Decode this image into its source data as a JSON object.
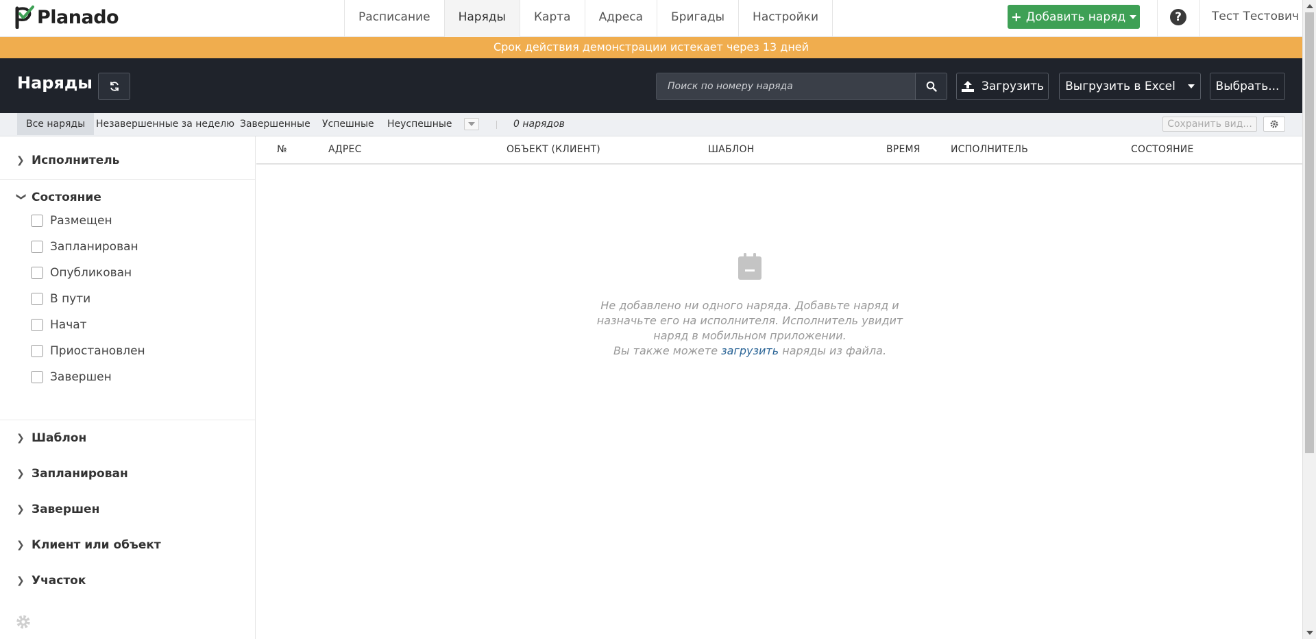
{
  "app": {
    "logo_text": "Planado"
  },
  "nav": {
    "links": [
      "Расписание",
      "Наряды",
      "Карта",
      "Адреса",
      "Бригады",
      "Настройки"
    ],
    "active": "Наряды",
    "add_button": "Добавить наряд",
    "help_icon": "question-circle-icon",
    "user_name": "Тест Тестович"
  },
  "banner": {
    "text": "Срок действия демонстрации истекает через 13 дней",
    "color": "#f0ad4e"
  },
  "header": {
    "title": "Наряды",
    "refresh_icon": "refresh-icon",
    "search_placeholder": "Поиск по номеру наряда",
    "upload_label": "Загрузить",
    "export_label": "Выгрузить в Excel",
    "select_label": "Выбрать..."
  },
  "tabs": {
    "items": [
      "Все наряды",
      "Незавершенные за неделю",
      "Завершенные",
      "Успешные",
      "Неуспешные"
    ],
    "active": "Все наряды",
    "count": "0 нарядов",
    "save_view": "Сохранить вид..."
  },
  "sidebar": {
    "performer": "Исполнитель",
    "status": {
      "title": "Состояние",
      "options": [
        "Размещен",
        "Запланирован",
        "Опубликован",
        "В пути",
        "Начат",
        "Приостановлен",
        "Завершен"
      ]
    },
    "template": "Шаблон",
    "scheduled": "Запланирован",
    "finished": "Завершен",
    "client": "Клиент или объект",
    "area": "Участок"
  },
  "table": {
    "columns": [
      "№",
      "АДРЕС",
      "ОБЪЕКТ (КЛИЕНТ)",
      "ШАБЛОН",
      "ВРЕМЯ",
      "ИСПОЛНИТЕЛЬ",
      "СОСТОЯНИЕ"
    ]
  },
  "empty_state": {
    "icon": "calendar-minus-icon",
    "line1": "Не добавлено ни одного наряда. Добавьте наряд и",
    "line2": "назначьте его на исполнителя. Исполнитель увидит",
    "line3": "наряд в мобильном приложении.",
    "line4_before": "Вы также можете ",
    "line4_link": "загрузить",
    "line4_after": " наряды из файла."
  },
  "colors": {
    "accent_green": "#3ea055",
    "dark_header": "#1f232b",
    "link_blue": "#2a6496"
  }
}
